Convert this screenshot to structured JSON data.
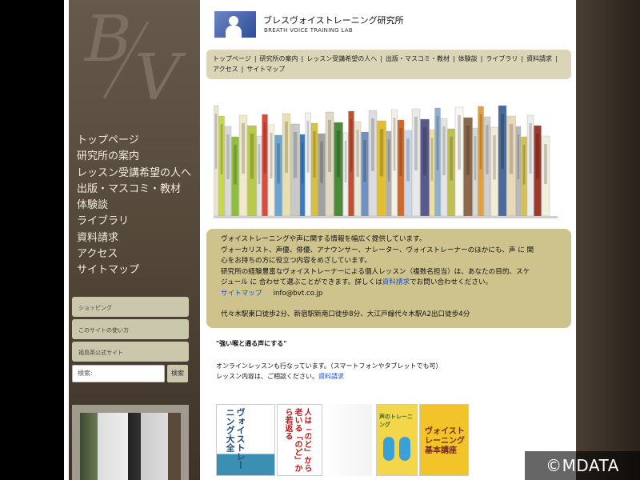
{
  "sidebar": {
    "nav": [
      "トップページ",
      "研究所の案内",
      "レッスン受講希望の人へ",
      "出版・マスコミ・教材",
      "体験談",
      "ライブラリ",
      "資料請求",
      "アクセス",
      "サイトマップ"
    ],
    "boxes": [
      "ショッピング",
      "このサイトの使い方",
      "福島英公式サイト"
    ],
    "search_placeholder": "検索:",
    "search_button": "検索"
  },
  "header": {
    "title": "ブレスヴォイストレーニング研究所",
    "subtitle": "BREATH VOICE TRAINING LAB"
  },
  "top_nav": [
    "トップページ",
    "研究所の案内",
    "レッスン受講希望の人へ",
    "出版・マスコミ・教材",
    "体験談",
    "ライブラリ",
    "資料請求",
    "アクセス",
    "サイトマップ"
  ],
  "info": {
    "line1": "ヴォイストレーニングや声に関する情報を幅広く提供しています。",
    "line2": "ヴォーカリスト、声優、俳優、アナウンサー、ナレーター、ヴォイストレーナーのほかにも、声 に 関",
    "line3": "心をお持ちの方に役立つ内容をめざしています。",
    "line4": "研究所の経験豊富なヴォイストレーナーによる個人レッスン（複数名担当）は、あなたの目的、スケ",
    "line5_pre": "ジュール に 合わせて選ぶことができます。詳しくは",
    "line5_link": "資料請求",
    "line5_post": "でお問い合わせください。",
    "sitemap_link": "サイトマップ",
    "email": "info@bvt.co.jp",
    "address": "代々木駅東口徒歩2分、新宿駅新南口徒歩8分、大江戸線代々木駅A2出口徒歩4分"
  },
  "main": {
    "heading": "\"強い喉と通る声にする\"",
    "line1": "オンラインレッスンも行なっています。（スマートフォンやタブレットでも可）",
    "line2_pre": "レッスン内容は、ご相談ください。",
    "line2_link": "資料請求"
  },
  "books": [
    {
      "title": "ヴォイストレーニング大全"
    },
    {
      "title": "人は「のど」から老いる「のど」から若返る"
    },
    {
      "title": "声のトレーニング"
    },
    {
      "title": "ヴォイストレーニング基本講座"
    }
  ],
  "watermark": "©MDATA"
}
